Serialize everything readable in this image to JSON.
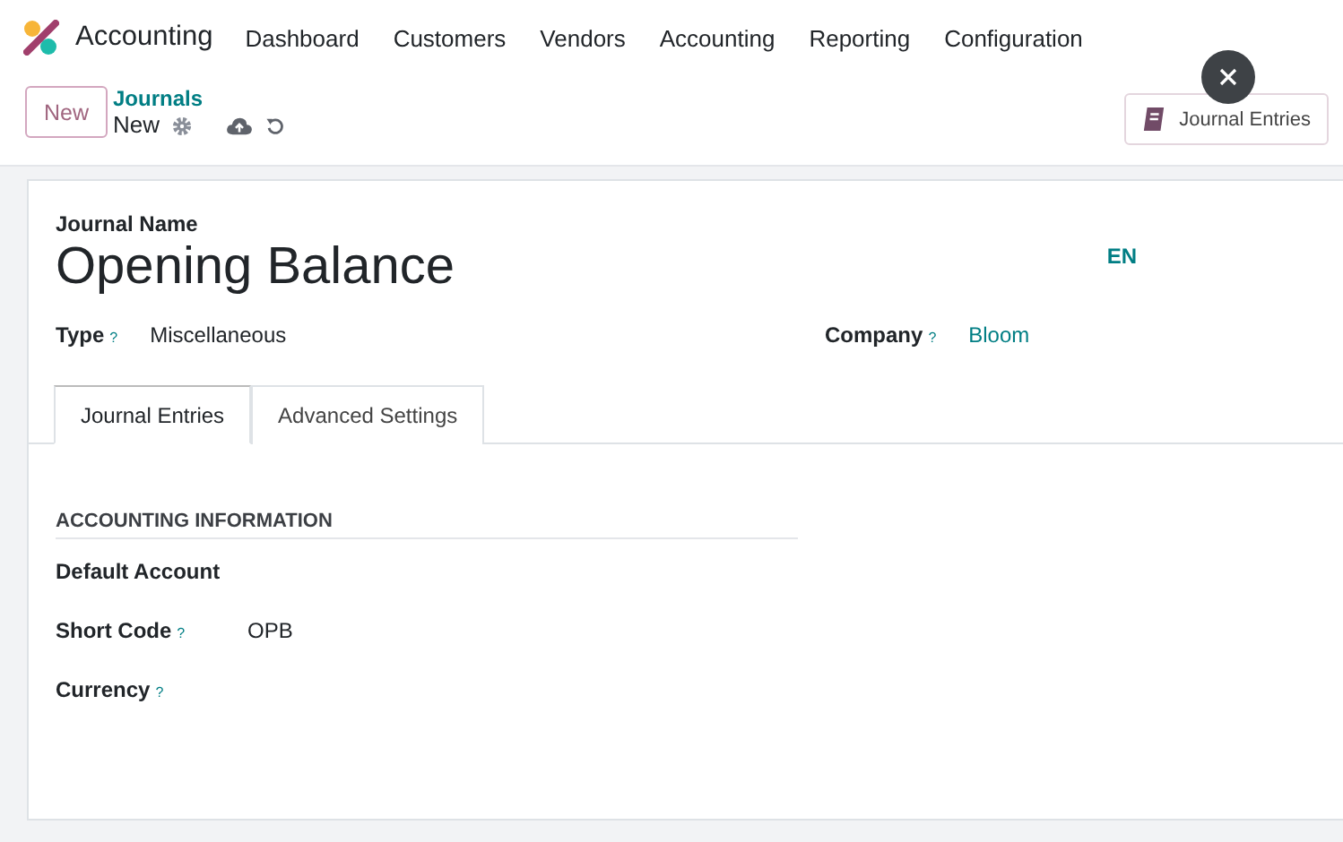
{
  "app": {
    "name": "Accounting"
  },
  "menu": [
    "Dashboard",
    "Customers",
    "Vendors",
    "Accounting",
    "Reporting",
    "Configuration"
  ],
  "control": {
    "new_button": "New",
    "breadcrumb": "Journals",
    "record": "New",
    "smart_button": "Journal Entries"
  },
  "form": {
    "name_label": "Journal Name",
    "name": "Opening Balance",
    "lang": "EN",
    "header_fields": [
      {
        "label": "Type",
        "help": "?",
        "value": "Miscellaneous",
        "kind": "text"
      },
      {
        "label": "Company",
        "help": "?",
        "value": "Bloom",
        "kind": "link"
      }
    ]
  },
  "tabs": [
    {
      "label": "Journal Entries",
      "selected": true
    },
    {
      "label": "Advanced Settings",
      "selected": false
    }
  ],
  "section": {
    "title": "ACCOUNTING INFORMATION",
    "fields": [
      {
        "label": "Default Account"
      },
      {
        "label": "Short Code",
        "help": "?",
        "value": "OPB"
      },
      {
        "label": "Currency",
        "help": "?"
      }
    ]
  }
}
